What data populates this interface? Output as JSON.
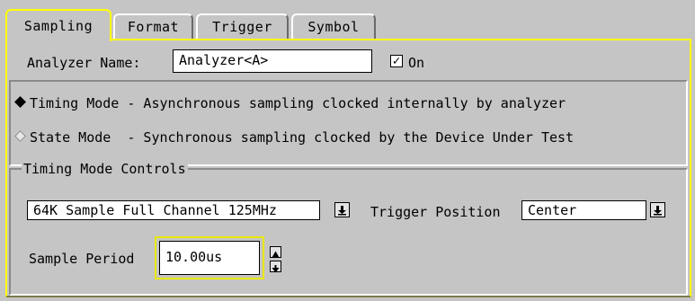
{
  "tabs": [
    {
      "label": "Sampling"
    },
    {
      "label": "Format"
    },
    {
      "label": "Trigger"
    },
    {
      "label": "Symbol"
    }
  ],
  "analyzer": {
    "name_label": "Analyzer Name:",
    "name_value": "Analyzer<A>",
    "on_label": "On",
    "on_checked": true
  },
  "modes": {
    "timing": {
      "label": "Timing Mode - Asynchronous sampling clocked internally by analyzer",
      "selected": true
    },
    "state": {
      "label": "State Mode  - Synchronous sampling clocked by the Device Under Test",
      "selected": false
    }
  },
  "controls": {
    "legend": "Timing Mode Controls",
    "sample_mode_value": "64K Sample Full Channel 125MHz",
    "trigger_position_label": "Trigger Position",
    "trigger_position_value": "Center",
    "sample_period_label": "Sample Period",
    "sample_period_value": "10.00us"
  },
  "icons": {
    "dropdown": "dropdown-arrow-icon",
    "spin_up": "spin-up-icon",
    "spin_down": "spin-down-icon",
    "check": "checkmark-icon"
  },
  "colors": {
    "background": "#c5c5c5",
    "accent": "#ffff00"
  }
}
